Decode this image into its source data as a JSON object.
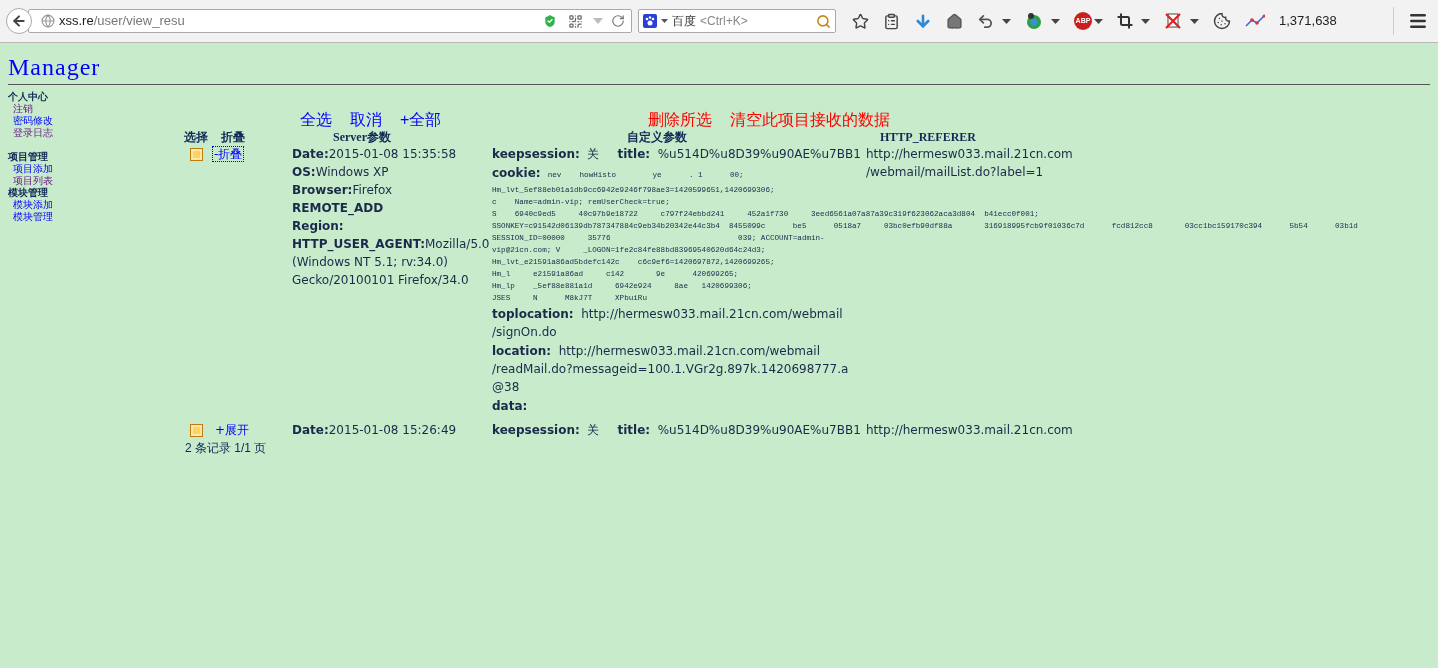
{
  "browser": {
    "url_host": "xss.re",
    "url_path": "/user/view_resu",
    "search_engine": "百度",
    "search_placeholder": "<Ctrl+K>",
    "abp_label": "ABP",
    "counter": "1,371,638"
  },
  "page": {
    "title": "Manager"
  },
  "sidebar": [
    {
      "heading": "个人中心",
      "items": [
        {
          "label": "注销",
          "visited": true
        },
        {
          "label": "密码修改",
          "visited": false
        },
        {
          "label": "登录日志",
          "visited": true
        }
      ]
    },
    {
      "heading": "项目管理",
      "items": [
        {
          "label": "项目添加",
          "visited": false
        },
        {
          "label": "项目列表",
          "visited": true
        }
      ]
    },
    {
      "heading": "模块管理",
      "items": [
        {
          "label": "模块添加",
          "visited": false
        },
        {
          "label": "模块管理",
          "visited": false
        }
      ]
    }
  ],
  "actions": [
    {
      "label": "全选",
      "color": "#0000ff"
    },
    {
      "label": "取消",
      "color": "#0000ff"
    },
    {
      "label": "+全部",
      "color": "#0000ff"
    },
    {
      "label": "删除所选",
      "color": "#ff0000"
    },
    {
      "label": "清空此项目接收的数据",
      "color": "#ff0000"
    }
  ],
  "table": {
    "columns": [
      "选择",
      "折叠",
      "Server参数",
      "自定义参数",
      "HTTP_REFERER"
    ],
    "rows": [
      {
        "checked": false,
        "toggle": "-折叠",
        "focused": true,
        "expanded": true,
        "server": [
          {
            "label": "Date:",
            "lines": [
              "2015-01-08 15:35:58"
            ]
          },
          {
            "label": "OS:",
            "lines": [
              "Windows XP"
            ]
          },
          {
            "label": "Browser:",
            "lines": [
              "Firefox"
            ]
          },
          {
            "label": "REMOTE_ADD"
          },
          {
            "label": "Region:"
          },
          {
            "label": "HTTP_USER_AGENT:",
            "lines": [
              "Mozilla/5.0",
              "(Windows NT 5.1; rv:34.0)",
              "Gecko/20100101 Firefox/34.0"
            ]
          }
        ],
        "custom_header": [
          {
            "label": "keepsession:",
            "value": "关"
          },
          {
            "label": "title:",
            "value": "%u514D%u8D39%u90AE%u7BB1"
          }
        ],
        "custom": [
          {
            "kind": "mono",
            "label": "cookie:",
            "lines": [
              "nev    howHisto        ye      . 1      00;",
              "Hm_lvt_5ef88eb01a1db9cc6942e9246f798ae3=1420599651,1420699306;",
              "c    Name=admin-vip; remUserCheck=true;",
              "S    6940c9ed5     40c97b9e18722     c797f24ebbd241     452a1f730     3eed6561a07a87a39c319f623062aca3d804  b41ecc0f001;",
              "SSONKEY=c91542d06139db787347884c9eb34b20342e44c3b4  8455099c      be5      0518a7     03bc0efb90df88a       316918995fcb9f01036c7d      fcd812cc8       03cc1bc159170c394      5b54      03b1d",
              "SESSION_ID=00000     35776                            039; ACCOUNT=admin-",
              "vip@21cn.com; V     _LOGON=1fe2c84fe88bd83969540620d64c24d3;",
              "Hm_lvt_e21591a86ad5bdefc142c    c6c9ef6=1420697872,1420699265;",
              "Hm_l     e21591a86ad     c142       9e      420699265;",
              "Hm_lp    _5ef88e881a1d     6942e924     8ae   1420699306;",
              "JSES     N      M8kJ7T     XPbuiRu"
            ]
          },
          {
            "kind": "text",
            "label": "toplocation:",
            "lines": [
              "http://hermesw033.mail.21cn.com/webmail",
              "/signOn.do"
            ]
          },
          {
            "kind": "text",
            "label": "location:",
            "lines": [
              "http://hermesw033.mail.21cn.com/webmail",
              "/readMail.do?messageid=100.1.VGr2g.897k.1420698777.a",
              "@38"
            ]
          },
          {
            "kind": "text",
            "label": "data:"
          }
        ],
        "referer": [
          "http://hermesw033.mail.21cn.com",
          "/webmail/mailList.do?label=1"
        ]
      },
      {
        "checked": false,
        "toggle": "+展开",
        "focused": false,
        "expanded": false,
        "server": [
          {
            "label": "Date:",
            "lines": [
              "2015-01-08 15:26:49"
            ]
          }
        ],
        "custom_header": [
          {
            "label": "keepsession:",
            "value": "关"
          },
          {
            "label": "title:",
            "value": "%u514D%u8D39%u90AE%u7BB1"
          }
        ],
        "custom": [],
        "referer": [
          "http://hermesw033.mail.21cn.com"
        ]
      }
    ]
  },
  "footer": "2 条记录 1/1 页"
}
